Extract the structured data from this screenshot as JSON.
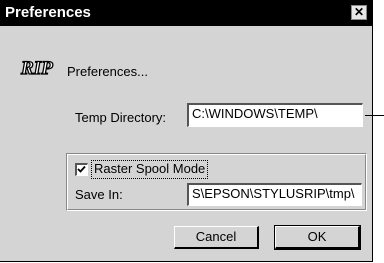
{
  "window": {
    "title": "Preferences",
    "close_glyph": "✕"
  },
  "header": {
    "logo_text": "RIP",
    "label": "Preferences..."
  },
  "temp_directory": {
    "label": "Temp Directory:",
    "value": "C:\\WINDOWS\\TEMP\\"
  },
  "raster_spool": {
    "checkbox_label": "Raster Spool Mode",
    "checked": true,
    "save_label": "Save In:",
    "save_value": "S\\EPSON\\STYLUSRIP\\tmp\\"
  },
  "buttons": {
    "cancel": "Cancel",
    "ok": "OK"
  },
  "icons": [
    "close-icon",
    "rip-logo-icon",
    "checkmark-icon"
  ]
}
